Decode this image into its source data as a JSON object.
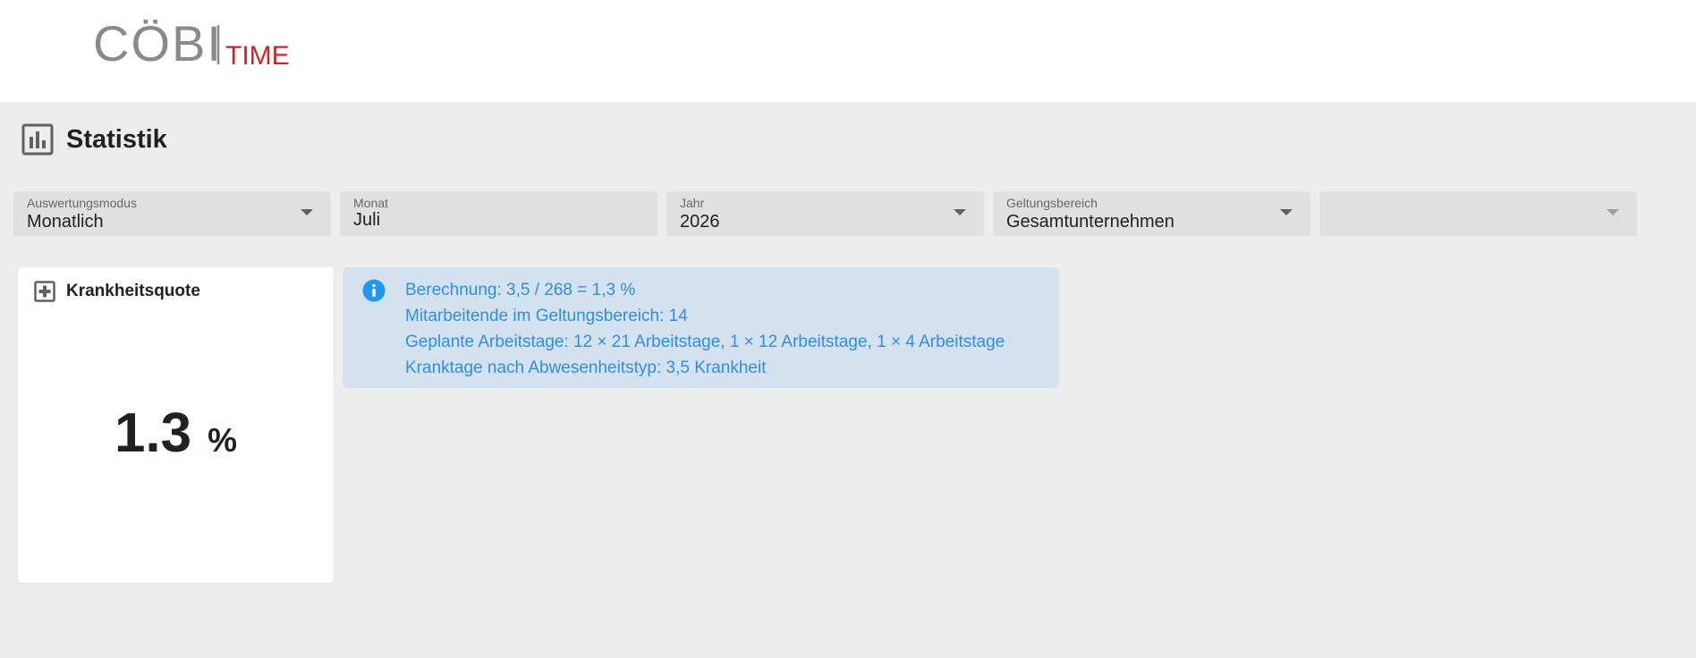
{
  "brand": {
    "logo_primary": "CÖBI",
    "logo_secondary": "TIME",
    "accent_color": "#c62828",
    "gray_color": "#8a8a8a"
  },
  "page": {
    "title": "Statistik",
    "title_icon": "bar-chart-icon"
  },
  "filters": [
    {
      "label": "Auswertungsmodus",
      "value": "Monatlich",
      "has_dropdown": true
    },
    {
      "label": "Monat",
      "value": "Juli",
      "has_dropdown": false
    },
    {
      "label": "Jahr",
      "value": "2026",
      "has_dropdown": true
    },
    {
      "label": "Geltungsbereich",
      "value": "Gesamtunternehmen",
      "has_dropdown": true
    },
    {
      "label": "",
      "value": "",
      "has_dropdown": true
    }
  ],
  "kpi": {
    "title": "Krankheitsquote",
    "icon": "plus-box-icon",
    "value": "1.3",
    "unit": "%"
  },
  "info": {
    "icon": "info-circle-icon",
    "color": "#2f8de4",
    "lines": [
      "Berechnung: 3,5 / 268 = 1,3 %",
      "Mitarbeitende im Geltungsbereich: 14",
      "Geplante Arbeitstage: 12 × 21 Arbeitstage, 1 × 12 Arbeitstage, 1 × 4 Arbeitstage",
      "Kranktage nach Abwesenheitstyp: 3,5 Krankheit"
    ]
  }
}
